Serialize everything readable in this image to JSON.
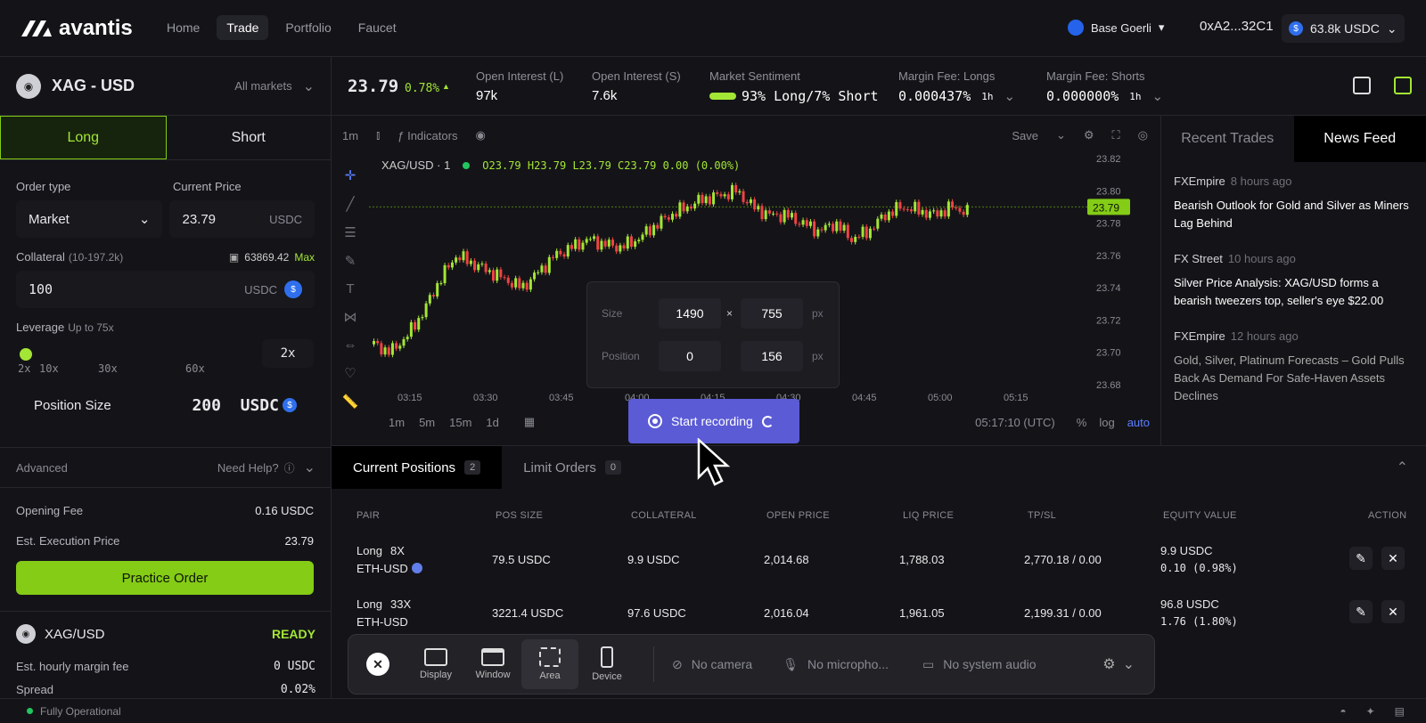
{
  "brand": {
    "name": "avantis"
  },
  "nav": [
    "Home",
    "Trade",
    "Portfolio",
    "Faucet"
  ],
  "network": {
    "name": "Base Goerli"
  },
  "wallet": {
    "address": "0xA2...32C1",
    "balance": "63.8k USDC"
  },
  "pair": {
    "name": "XAG - USD",
    "markets": "All markets"
  },
  "stats": {
    "price": "23.79",
    "change": "0.78%",
    "oi_long_label": "Open Interest (L)",
    "oi_long": "97k",
    "oi_short_label": "Open Interest (S)",
    "oi_short": "7.6k",
    "sentiment_label": "Market Sentiment",
    "sentiment": "93% Long/7% Short",
    "fee_long_label": "Margin Fee: Longs",
    "fee_long": "0.000437%",
    "fee_short_label": "Margin Fee: Shorts",
    "fee_short": "0.000000%",
    "period": "1h"
  },
  "order": {
    "long": "Long",
    "short": "Short",
    "type_label": "Order type",
    "type": "Market",
    "price_label": "Current Price",
    "price": "23.79",
    "unit": "USDC",
    "collateral_label": "Collateral",
    "collateral_range": "(10-197.2k)",
    "wallet_bal": "63869.42",
    "max": "Max",
    "collateral": "100",
    "leverage_label": "Leverage",
    "leverage_hint": "Up to 75x",
    "leverage_ticks": [
      "2x",
      "10x",
      "30x",
      "60x"
    ],
    "leverage": "2x",
    "pos_size_label": "Position Size",
    "pos_size": "200  USDC",
    "advanced": "Advanced",
    "help": "Need Help?",
    "fee_label": "Opening Fee",
    "fee": "0.16 USDC",
    "exec_label": "Est. Execution Price",
    "exec": "23.79",
    "cta": "Practice Order",
    "pair_short": "XAG/USD",
    "status": "READY",
    "hourly_label": "Est. hourly margin fee",
    "hourly": "0 USDC",
    "spread_label": "Spread",
    "spread": "0.02%"
  },
  "chart": {
    "toolbar": {
      "interval": "1m",
      "indicators": "Indicators",
      "save": "Save"
    },
    "legend": {
      "symbol": "XAG/USD · 1",
      "ohlc": "O23.79 H23.79 L23.79 C23.79 0.00 (0.00%)"
    },
    "bottom": {
      "intervals": [
        "1m",
        "5m",
        "15m",
        "1d"
      ],
      "clock": "05:17:10 (UTC)",
      "pct": "%",
      "log": "log",
      "auto": "auto"
    },
    "price_tag": "23.79"
  },
  "chart_data": {
    "type": "candlestick",
    "x_ticks": [
      "03:15",
      "03:30",
      "03:45",
      "04:00",
      "04:15",
      "04:30",
      "04:45",
      "05:00",
      "05:15"
    ],
    "y_ticks": [
      "23.82",
      "23.80",
      "23.78",
      "23.76",
      "23.74",
      "23.72",
      "23.70",
      "23.68"
    ],
    "ylim": [
      23.68,
      23.82
    ],
    "close": [
      23.705,
      23.7,
      23.71,
      23.725,
      23.745,
      23.76,
      23.755,
      23.75,
      23.745,
      23.74,
      23.75,
      23.76,
      23.765,
      23.77,
      23.767,
      23.765,
      23.77,
      23.778,
      23.785,
      23.79,
      23.795,
      23.797,
      23.8,
      23.79,
      23.785,
      23.785,
      23.78,
      23.775,
      23.78,
      23.77,
      23.775,
      23.785,
      23.79,
      23.788,
      23.785,
      23.79,
      23.787
    ],
    "last": 23.79
  },
  "news": {
    "tabs": [
      "Recent Trades",
      "News Feed"
    ],
    "items": [
      {
        "source": "FXEmpire",
        "time": "8 hours ago",
        "title": "Bearish Outlook for Gold and Silver as Miners Lag Behind"
      },
      {
        "source": "FX Street",
        "time": "10 hours ago",
        "title": "Silver Price Analysis: XAG/USD forms a bearish tweezers top, seller's eye $22.00"
      },
      {
        "source": "FXEmpire",
        "time": "12 hours ago",
        "title": "Gold, Silver, Platinum Forecasts – Gold Pulls Back As Demand For Safe-Haven Assets Declines"
      }
    ]
  },
  "positions": {
    "tabs": [
      {
        "label": "Current Positions",
        "count": "2"
      },
      {
        "label": "Limit Orders",
        "count": "0"
      }
    ],
    "headers": [
      "PAIR",
      "POS SIZE",
      "COLLATERAL",
      "OPEN PRICE",
      "LIQ PRICE",
      "TP/SL",
      "EQUITY VALUE",
      "ACTION"
    ],
    "rows": [
      {
        "side": "Long",
        "lev": "8X",
        "pair": "ETH-USD",
        "size": "79.5 USDC",
        "coll": "9.9 USDC",
        "open": "2,014.68",
        "liq": "1,788.03",
        "tpsl": "2,770.18 / 0.00",
        "equity": "9.9 USDC",
        "pnl": "0.10 (0.98%)"
      },
      {
        "side": "Long",
        "lev": "33X",
        "pair": "ETH-USD",
        "size": "3221.4 USDC",
        "coll": "97.6 USDC",
        "open": "2,016.04",
        "liq": "1,961.05",
        "tpsl": "2,199.31 / 0.00",
        "equity": "96.8 USDC",
        "pnl": "1.76 (1.80%)"
      }
    ]
  },
  "overlay": {
    "size_label": "Size",
    "w": "1490",
    "x": "×",
    "h": "755",
    "px": "px",
    "pos_label": "Position",
    "px_x": "0",
    "px_y": "156",
    "start": "Start recording"
  },
  "recorder": {
    "items": [
      "Display",
      "Window",
      "Area",
      "Device"
    ],
    "camera": "No camera",
    "mic": "No micropho...",
    "audio": "No system audio"
  },
  "footer": {
    "status": "Fully Operational"
  }
}
